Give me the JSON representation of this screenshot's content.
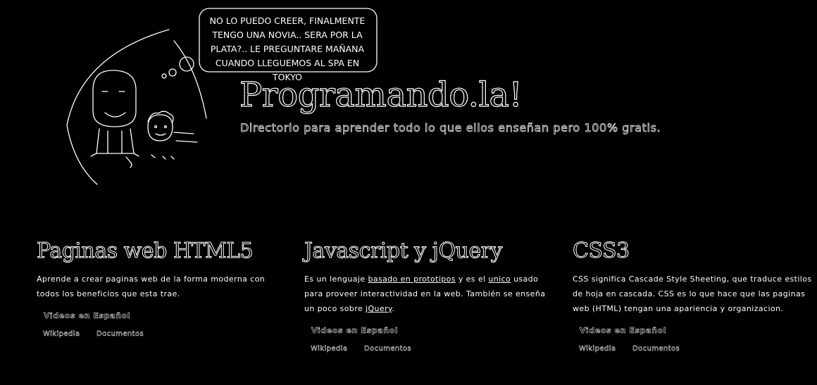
{
  "header": {
    "bubble_lines": [
      "NO LO PUEDO CREER, FINALMENTE",
      "TENGO UNA NOVIA.. SERA POR LA",
      "PLATA?.. LE PREGUNTARE MAÑANA",
      "CUANDO LLEGUEMOS AL SPA EN TOKYO"
    ],
    "title": "Programando.la!",
    "tagline": "Directorio para aprender todo lo que ellos enseñan pero 100% gratis."
  },
  "columns": [
    {
      "heading": "Paginas web HTML5",
      "desc_text": "Aprende a crear paginas web de la forma moderna con todos los beneficios que esta trae.",
      "video_label": "Videos en Español",
      "wiki_label": "Wikipedia",
      "docs_label": "Documentos"
    },
    {
      "heading": "Javascript y jQuery",
      "desc_parts": {
        "p1": "Es un lenguaje ",
        "link1": "basado en prototipos",
        "p2": " y es el ",
        "link2": "unico",
        "p3": " usado para proveer interactividad en la web. También se enseña un poco sobre ",
        "link3": "jQuery",
        "p4": "."
      },
      "video_label": "Videos en Español",
      "wiki_label": "Wikipedia",
      "docs_label": "Documentos"
    },
    {
      "heading": "CSS3",
      "desc_text": "CSS significa Cascade Style Sheeting, que traduce estilos de hoja en cascada. CSS es lo que hace que las paginas web (HTML) tengan una apariencia y organizacion.",
      "video_label": "Videos en Español",
      "wiki_label": "Wikipedia",
      "docs_label": "Documentos"
    }
  ]
}
